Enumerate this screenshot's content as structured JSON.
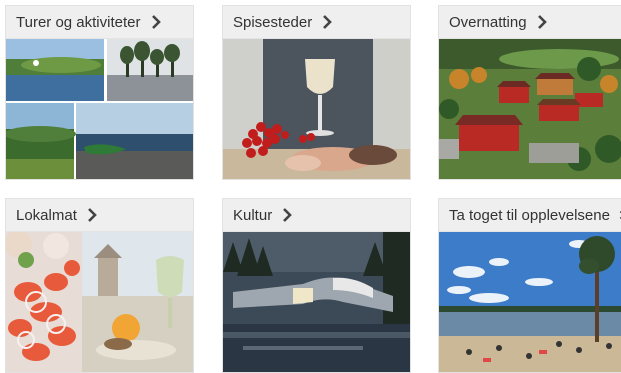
{
  "cards": [
    {
      "title": "Turer og aktiviteter",
      "image": "collage-lake-forest-boat"
    },
    {
      "title": "Spisesteder",
      "image": "wine-glass-berries-charcuterie"
    },
    {
      "title": "Overnatting",
      "image": "aerial-red-farm-buildings"
    },
    {
      "title": "Lokalmat",
      "image": "salad-and-cheese-board"
    },
    {
      "title": "Kultur",
      "image": "twisted-bridge-museum"
    },
    {
      "title": "Ta toget til opplevelsene",
      "image": "lakeside-beach-pine"
    }
  ],
  "icons": {
    "chevron": "chevron-right-icon"
  },
  "colors": {
    "header_bg": "#efefef",
    "text": "#333333",
    "border": "#e2e2e2"
  }
}
